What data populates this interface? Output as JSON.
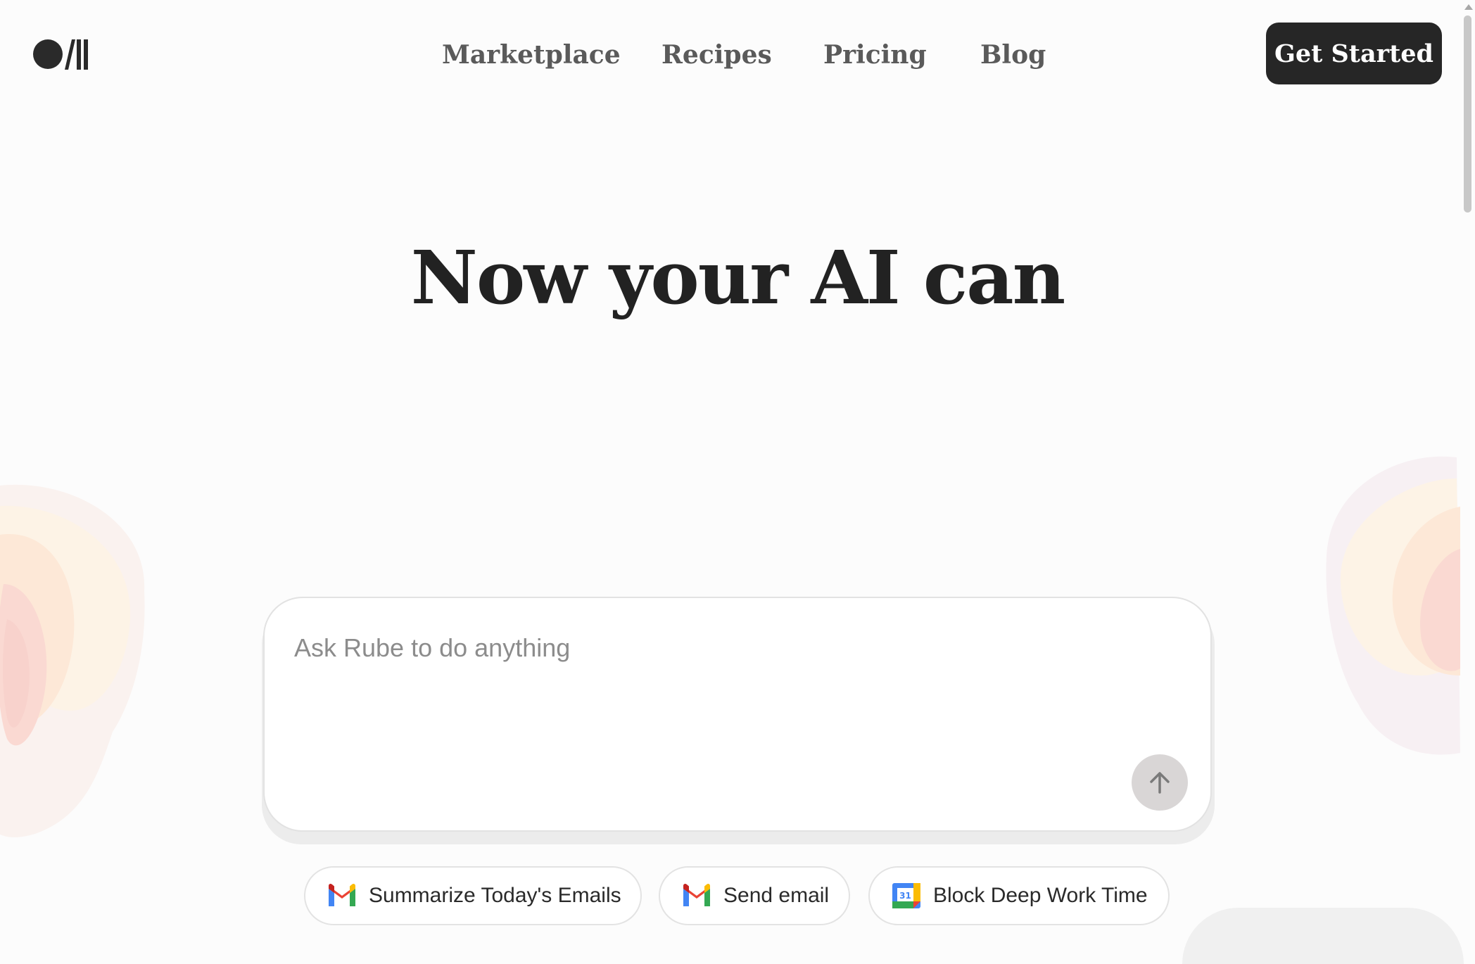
{
  "header": {
    "logo_icon": "brand-logo-icon",
    "nav": [
      {
        "label": "Marketplace"
      },
      {
        "label": "Recipes"
      },
      {
        "label": "Pricing"
      },
      {
        "label": "Blog"
      }
    ],
    "cta_label": "Get Started"
  },
  "hero": {
    "title": "Now your AI can"
  },
  "prompt": {
    "placeholder": "Ask Rube to do anything",
    "value": "",
    "send_icon": "arrow-up-icon"
  },
  "suggestions": [
    {
      "label": "Summarize Today's Emails",
      "icon": "gmail-icon"
    },
    {
      "label": "Send email",
      "icon": "gmail-icon"
    },
    {
      "label": "Block Deep Work Time",
      "icon": "google-calendar-icon",
      "icon_text": "31"
    }
  ],
  "colors": {
    "background": "#fcfcfc",
    "cta_background": "#262626",
    "nav_text": "#5a5a5a",
    "send_button": "#d9d6d6"
  }
}
